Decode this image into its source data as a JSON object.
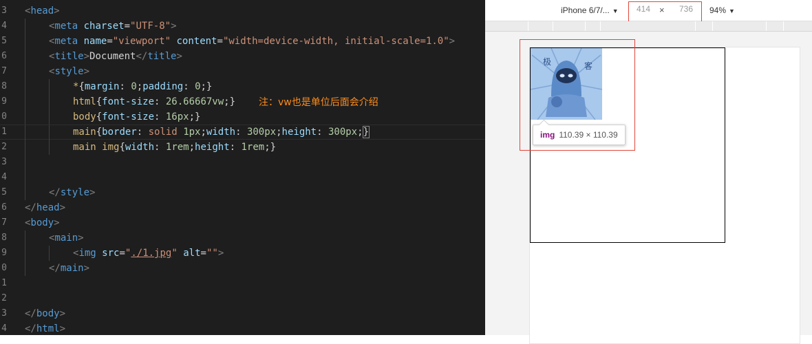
{
  "editor": {
    "lines": [
      {
        "ln": "3",
        "indent": 1,
        "tokens": [
          [
            "t-punc",
            "<"
          ],
          [
            "t-tag",
            "head"
          ],
          [
            "t-punc",
            ">"
          ]
        ]
      },
      {
        "ln": "4",
        "indent": 2,
        "tokens": [
          [
            "t-punc",
            "<"
          ],
          [
            "t-tag",
            "meta"
          ],
          [
            "t-txt",
            " "
          ],
          [
            "t-attr",
            "charset"
          ],
          [
            "t-txt",
            "="
          ],
          [
            "t-str",
            "\"UTF-8\""
          ],
          [
            "t-punc",
            ">"
          ]
        ]
      },
      {
        "ln": "5",
        "indent": 2,
        "tokens": [
          [
            "t-punc",
            "<"
          ],
          [
            "t-tag",
            "meta"
          ],
          [
            "t-txt",
            " "
          ],
          [
            "t-attr",
            "name"
          ],
          [
            "t-txt",
            "="
          ],
          [
            "t-str",
            "\"viewport\""
          ],
          [
            "t-txt",
            " "
          ],
          [
            "t-attr",
            "content"
          ],
          [
            "t-txt",
            "="
          ],
          [
            "t-str",
            "\"width=device-width, initial-scale=1.0\""
          ],
          [
            "t-punc",
            ">"
          ]
        ]
      },
      {
        "ln": "6",
        "indent": 2,
        "tokens": [
          [
            "t-punc",
            "<"
          ],
          [
            "t-tag",
            "title"
          ],
          [
            "t-punc",
            ">"
          ],
          [
            "t-txt",
            "Document"
          ],
          [
            "t-punc",
            "</"
          ],
          [
            "t-tag",
            "title"
          ],
          [
            "t-punc",
            ">"
          ]
        ]
      },
      {
        "ln": "7",
        "indent": 2,
        "tokens": [
          [
            "t-punc",
            "<"
          ],
          [
            "t-tag",
            "style"
          ],
          [
            "t-punc",
            ">"
          ]
        ]
      },
      {
        "ln": "8",
        "indent": 3,
        "tokens": [
          [
            "t-sel",
            "*"
          ],
          [
            "t-txt",
            "{"
          ],
          [
            "t-prop",
            "margin"
          ],
          [
            "t-txt",
            ": "
          ],
          [
            "t-num",
            "0"
          ],
          [
            "t-txt",
            ";"
          ],
          [
            "t-prop",
            "padding"
          ],
          [
            "t-txt",
            ": "
          ],
          [
            "t-num",
            "0"
          ],
          [
            "t-txt",
            ";}"
          ]
        ]
      },
      {
        "ln": "9",
        "indent": 3,
        "tokens": [
          [
            "t-sel",
            "html"
          ],
          [
            "t-txt",
            "{"
          ],
          [
            "t-prop",
            "font-size"
          ],
          [
            "t-txt",
            ": "
          ],
          [
            "t-num",
            "26.66667vw"
          ],
          [
            "t-txt",
            ";}"
          ]
        ]
      },
      {
        "ln": "0",
        "indent": 3,
        "tokens": [
          [
            "t-sel",
            "body"
          ],
          [
            "t-txt",
            "{"
          ],
          [
            "t-prop",
            "font-size"
          ],
          [
            "t-txt",
            ": "
          ],
          [
            "t-num",
            "16px"
          ],
          [
            "t-txt",
            ";}"
          ]
        ]
      },
      {
        "ln": "1",
        "indent": 3,
        "active": true,
        "tokens": [
          [
            "t-sel",
            "main"
          ],
          [
            "t-txt",
            "{"
          ],
          [
            "t-prop",
            "border"
          ],
          [
            "t-txt",
            ": "
          ],
          [
            "t-val",
            "solid"
          ],
          [
            "t-txt",
            " "
          ],
          [
            "t-num",
            "1px"
          ],
          [
            "t-txt",
            ";"
          ],
          [
            "t-prop",
            "width"
          ],
          [
            "t-txt",
            ": "
          ],
          [
            "t-num",
            "300px"
          ],
          [
            "t-txt",
            ";"
          ],
          [
            "t-prop",
            "height"
          ],
          [
            "t-txt",
            ": "
          ],
          [
            "t-num",
            "300px"
          ],
          [
            "t-txt",
            ";"
          ],
          [
            "bracket-hl",
            "}"
          ]
        ]
      },
      {
        "ln": "2",
        "indent": 3,
        "tokens": [
          [
            "t-sel",
            "main img"
          ],
          [
            "t-txt",
            "{"
          ],
          [
            "t-prop",
            "width"
          ],
          [
            "t-txt",
            ": "
          ],
          [
            "t-num",
            "1rem"
          ],
          [
            "t-txt",
            ";"
          ],
          [
            "t-prop",
            "height"
          ],
          [
            "t-txt",
            ": "
          ],
          [
            "t-num",
            "1rem"
          ],
          [
            "t-txt",
            ";}"
          ]
        ]
      },
      {
        "ln": "3",
        "indent": 2,
        "tokens": []
      },
      {
        "ln": "4",
        "indent": 2,
        "tokens": []
      },
      {
        "ln": "5",
        "indent": 2,
        "tokens": [
          [
            "t-punc",
            "</"
          ],
          [
            "t-tag",
            "style"
          ],
          [
            "t-punc",
            ">"
          ]
        ]
      },
      {
        "ln": "6",
        "indent": 1,
        "tokens": [
          [
            "t-punc",
            "</"
          ],
          [
            "t-tag",
            "head"
          ],
          [
            "t-punc",
            ">"
          ]
        ]
      },
      {
        "ln": "7",
        "indent": 1,
        "tokens": [
          [
            "t-punc",
            "<"
          ],
          [
            "t-tag",
            "body"
          ],
          [
            "t-punc",
            ">"
          ]
        ]
      },
      {
        "ln": "8",
        "indent": 2,
        "tokens": [
          [
            "t-punc",
            "<"
          ],
          [
            "t-tag",
            "main"
          ],
          [
            "t-punc",
            ">"
          ]
        ]
      },
      {
        "ln": "9",
        "indent": 3,
        "tokens": [
          [
            "t-punc",
            "<"
          ],
          [
            "t-tag",
            "img"
          ],
          [
            "t-txt",
            " "
          ],
          [
            "t-attr",
            "src"
          ],
          [
            "t-txt",
            "="
          ],
          [
            "t-str",
            "\""
          ],
          [
            "t-link",
            "./1.jpg"
          ],
          [
            "t-str",
            "\""
          ],
          [
            "t-txt",
            " "
          ],
          [
            "t-attr",
            "alt"
          ],
          [
            "t-txt",
            "="
          ],
          [
            "t-str",
            "\"\""
          ],
          [
            "t-punc",
            ">"
          ]
        ]
      },
      {
        "ln": "0",
        "indent": 2,
        "tokens": [
          [
            "t-punc",
            "</"
          ],
          [
            "t-tag",
            "main"
          ],
          [
            "t-punc",
            ">"
          ]
        ]
      },
      {
        "ln": "1",
        "indent": 1,
        "tokens": []
      },
      {
        "ln": "2",
        "indent": 1,
        "tokens": []
      },
      {
        "ln": "3",
        "indent": 1,
        "tokens": [
          [
            "t-punc",
            "</"
          ],
          [
            "t-tag",
            "body"
          ],
          [
            "t-punc",
            ">"
          ]
        ]
      },
      {
        "ln": "4",
        "indent": 1,
        "tokens": [
          [
            "t-punc",
            "</"
          ],
          [
            "t-tag",
            "html"
          ],
          [
            "t-punc",
            ">"
          ]
        ]
      }
    ],
    "note": "注：vw也是单位后面会介绍"
  },
  "device_toolbar": {
    "device": "iPhone 6/7/...",
    "width": "414",
    "times": "×",
    "height": "736",
    "zoom": "94%"
  },
  "tooltip": {
    "tag": "img",
    "size": "110.39 × 110.39"
  },
  "colors": {
    "editor_bg": "#1e1e1e",
    "note": "#ff8c1a",
    "highlight_border": "#e0453a",
    "image_bg": "#a4c6ea"
  }
}
